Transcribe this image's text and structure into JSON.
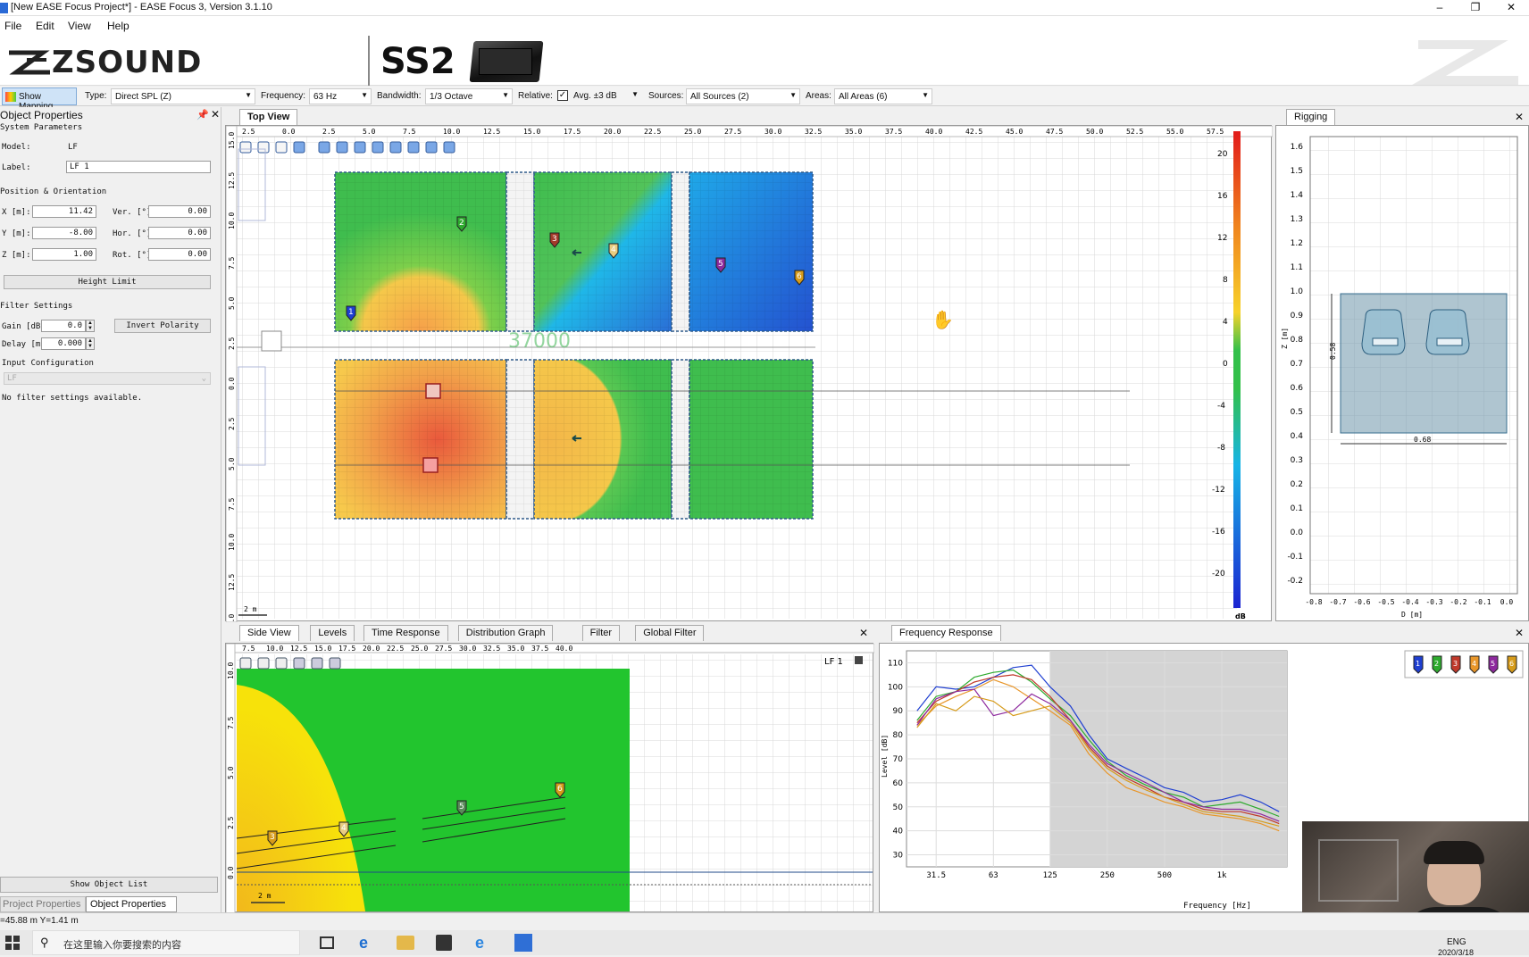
{
  "window": {
    "title": "[New EASE Focus Project*] - EASE Focus 3, Version 3.1.10"
  },
  "menu": [
    "File",
    "Edit",
    "View",
    "Help"
  ],
  "banner": {
    "brand": "ZSOUND",
    "model": "SS2"
  },
  "toolbar": {
    "show_mapping": "Show Mapping",
    "type_label": "Type:",
    "type_value": "Direct SPL (Z)",
    "frequency_label": "Frequency:",
    "frequency_value": "63 Hz",
    "bandwidth_label": "Bandwidth:",
    "bandwidth_value": "1/3 Octave",
    "relative_label": "Relative:",
    "avg_label": "Avg. ±3 dB",
    "sources_label": "Sources:",
    "sources_value": "All Sources (2)",
    "areas_label": "Areas:",
    "areas_value": "All Areas (6)"
  },
  "object_properties": {
    "title": "Object Properties",
    "system_parameters": "System Parameters",
    "model_label": "Model:",
    "model_value": "LF",
    "label_label": "Label:",
    "label_value": "LF 1",
    "position_header": "Position & Orientation",
    "x_label": "X [m]:",
    "x_value": "11.42",
    "y_label": "Y [m]:",
    "y_value": "-8.00",
    "z_label": "Z [m]:",
    "z_value": "1.00",
    "ver_label": "Ver. [°]:",
    "ver_value": "0.00",
    "hor_label": "Hor. [°]:",
    "hor_value": "0.00",
    "rot_label": "Rot. [°]:",
    "rot_value": "0.00",
    "height_limit": "Height Limit",
    "filter_header": "Filter Settings",
    "gain_label": "Gain [dB]:",
    "gain_value": "0.0",
    "invert_polarity": "Invert Polarity",
    "delay_label": "Delay [ms]:",
    "delay_value": "0.000",
    "input_header": "Input Configuration",
    "input_value": "LF",
    "no_filter": "No filter settings available.",
    "show_object_list": "Show Object List",
    "tab_project": "Project Properties",
    "tab_object": "Object Properties"
  },
  "top_view": {
    "tab": "Top View",
    "x_ticks": [
      "2.5",
      "0.0",
      "2.5",
      "5.0",
      "7.5",
      "10.0",
      "12.5",
      "15.0",
      "17.5",
      "20.0",
      "22.5",
      "25.0",
      "27.5",
      "30.0",
      "32.5",
      "35.0",
      "37.5",
      "40.0",
      "42.5",
      "45.0",
      "47.5",
      "50.0",
      "52.5",
      "55.0",
      "57.5"
    ],
    "y_ticks": [
      "15.0",
      "12.5",
      "10.0",
      "7.5",
      "5.0",
      "2.5",
      "0.0",
      "2.5",
      "5.0",
      "7.5",
      "10.0",
      "12.5",
      "15.0"
    ],
    "colorbar_ticks": [
      "20",
      "16",
      "12",
      "8",
      "4",
      "0",
      "-4",
      "-8",
      "-12",
      "-16",
      "-20"
    ],
    "colorbar_unit": "dB",
    "scale_label": "2 m",
    "watermark": "37000",
    "markers": [
      "1",
      "2",
      "3",
      "4",
      "5",
      "6"
    ]
  },
  "rigging": {
    "tab": "Rigging",
    "y_ticks": [
      "1.6",
      "1.5",
      "1.4",
      "1.3",
      "1.2",
      "1.1",
      "1.0",
      "0.9",
      "0.8",
      "0.7",
      "0.6",
      "0.5",
      "0.4",
      "0.3",
      "0.2",
      "0.1",
      "0.0",
      "-0.1",
      "-0.2"
    ],
    "x_ticks": [
      "-0.8",
      "-0.7",
      "-0.6",
      "-0.5",
      "-0.4",
      "-0.3",
      "-0.2",
      "-0.1",
      "0.0"
    ],
    "z_label": "Z [m]",
    "d_label": "D [m]",
    "height_dim": "0.58",
    "width_dim": "0.68"
  },
  "side_view": {
    "tabs": [
      "Side View",
      "Levels",
      "Time Response",
      "Distribution Graph",
      "Filter",
      "Global Filter"
    ],
    "x_ticks": [
      "7.5",
      "10.0",
      "12.5",
      "15.0",
      "17.5",
      "20.0",
      "22.5",
      "25.0",
      "27.5",
      "30.0",
      "32.5",
      "35.0",
      "37.5",
      "40.0"
    ],
    "y_ticks": [
      "10.0",
      "7.5",
      "5.0",
      "2.5",
      "0.0"
    ],
    "source_label": "LF 1",
    "scale_label": "2 m",
    "markers": [
      "3",
      "4",
      "5",
      "6"
    ]
  },
  "frequency_response": {
    "tab": "Frequency Response",
    "y_label": "Level [dB]",
    "x_label": "Frequency [Hz]",
    "legend": [
      "1",
      "2",
      "3",
      "4",
      "5",
      "6"
    ]
  },
  "chart_data": {
    "type": "line",
    "title": "",
    "xlabel": "Frequency [Hz]",
    "ylabel": "Level [dB]",
    "x_ticks": [
      "31.5",
      "63",
      "125",
      "250",
      "500",
      "1k"
    ],
    "y_ticks": [
      "110",
      "100",
      "90",
      "80",
      "70",
      "60",
      "50",
      "40",
      "30"
    ],
    "ylim": [
      25,
      115
    ],
    "x": [
      25,
      31.5,
      40,
      50,
      63,
      80,
      100,
      125,
      160,
      200,
      250,
      315,
      400,
      500,
      630,
      800,
      1000,
      1250,
      1600,
      2000
    ],
    "series": [
      {
        "name": "1",
        "color": "#1f3fd1",
        "values": [
          90,
          100,
          99,
          100,
          104,
          108,
          109,
          100,
          92,
          80,
          70,
          66,
          62,
          58,
          56,
          52,
          53,
          55,
          52,
          48
        ]
      },
      {
        "name": "2",
        "color": "#2eaa2e",
        "values": [
          86,
          96,
          98,
          104,
          106,
          107,
          102,
          95,
          88,
          78,
          69,
          63,
          59,
          56,
          54,
          50,
          51,
          52,
          49,
          46
        ]
      },
      {
        "name": "3",
        "color": "#c0392b",
        "values": [
          85,
          94,
          98,
          102,
          104,
          105,
          103,
          96,
          86,
          75,
          67,
          62,
          58,
          54,
          52,
          49,
          48,
          48,
          46,
          43
        ]
      },
      {
        "name": "4",
        "color": "#e8962a",
        "values": [
          84,
          92,
          96,
          99,
          103,
          100,
          95,
          90,
          84,
          72,
          64,
          58,
          55,
          52,
          50,
          47,
          46,
          45,
          43,
          40
        ]
      },
      {
        "name": "5",
        "color": "#8e2a9e",
        "values": [
          84,
          95,
          98,
          99,
          88,
          90,
          97,
          93,
          86,
          76,
          68,
          64,
          60,
          56,
          52,
          50,
          49,
          49,
          47,
          44
        ]
      },
      {
        "name": "6",
        "color": "#d69b1a",
        "values": [
          83,
          93,
          90,
          96,
          94,
          88,
          90,
          92,
          85,
          74,
          66,
          61,
          57,
          54,
          51,
          48,
          47,
          46,
          44,
          42
        ]
      }
    ],
    "shaded_above_hz": 125
  },
  "status": {
    "coords": "=45.88 m Y=1.41 m"
  },
  "taskbar": {
    "search_placeholder": "在这里输入你要搜索的内容",
    "lang": "ENG",
    "date": "2020/3/18"
  }
}
